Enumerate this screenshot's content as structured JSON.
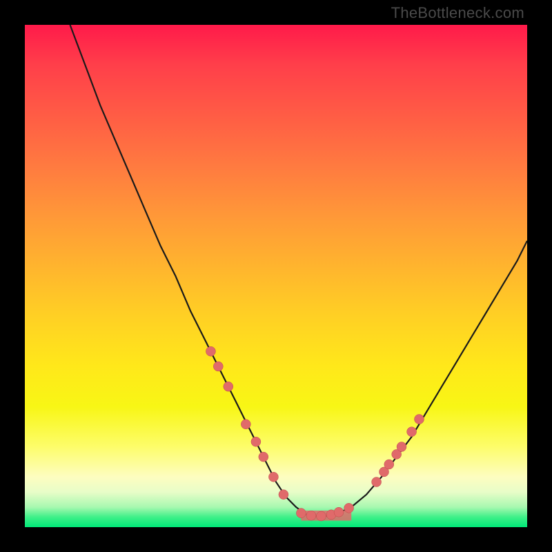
{
  "watermark": "TheBottleneck.com",
  "colors": {
    "curve": "#1a1a1a",
    "marker_fill": "#e06a6a",
    "marker_stroke": "#bf4a4a",
    "frame": "#000000"
  },
  "chart_data": {
    "type": "line",
    "title": "",
    "xlabel": "",
    "ylabel": "",
    "xlim": [
      0,
      100
    ],
    "ylim": [
      0,
      100
    ],
    "grid": false,
    "series": [
      {
        "name": "bottleneck-curve",
        "x": [
          9,
          12,
          15,
          18,
          21,
          24,
          27,
          30,
          33,
          36,
          38,
          40,
          42,
          44,
          46,
          48,
          50,
          52,
          54,
          56,
          58,
          60,
          62,
          65,
          68,
          71,
          74,
          77,
          80,
          83,
          86,
          89,
          92,
          95,
          98,
          100
        ],
        "y": [
          100,
          92,
          84,
          77,
          70,
          63,
          56,
          50,
          43,
          37,
          33,
          29,
          25,
          21,
          17,
          13,
          9,
          6,
          4,
          2.5,
          2.2,
          2.2,
          2.6,
          4,
          6.5,
          10,
          14,
          18,
          23,
          28,
          33,
          38,
          43,
          48,
          53,
          57
        ]
      }
    ],
    "markers": [
      {
        "x": 37,
        "y": 35
      },
      {
        "x": 38.5,
        "y": 32
      },
      {
        "x": 40.5,
        "y": 28
      },
      {
        "x": 44,
        "y": 20.5
      },
      {
        "x": 46,
        "y": 17
      },
      {
        "x": 47.5,
        "y": 14
      },
      {
        "x": 49.5,
        "y": 10
      },
      {
        "x": 51.5,
        "y": 6.5
      },
      {
        "x": 55,
        "y": 2.8
      },
      {
        "x": 57,
        "y": 2.3
      },
      {
        "x": 59,
        "y": 2.2
      },
      {
        "x": 61,
        "y": 2.5
      },
      {
        "x": 62.5,
        "y": 3.0
      },
      {
        "x": 64.5,
        "y": 3.8
      },
      {
        "x": 70,
        "y": 9
      },
      {
        "x": 71.5,
        "y": 11
      },
      {
        "x": 72.5,
        "y": 12.5
      },
      {
        "x": 74,
        "y": 14.5
      },
      {
        "x": 75,
        "y": 16
      },
      {
        "x": 77,
        "y": 19
      },
      {
        "x": 78.5,
        "y": 21.5
      }
    ],
    "flat_band": {
      "x1": 55,
      "x2": 65,
      "y": 2.3,
      "height": 2
    }
  }
}
